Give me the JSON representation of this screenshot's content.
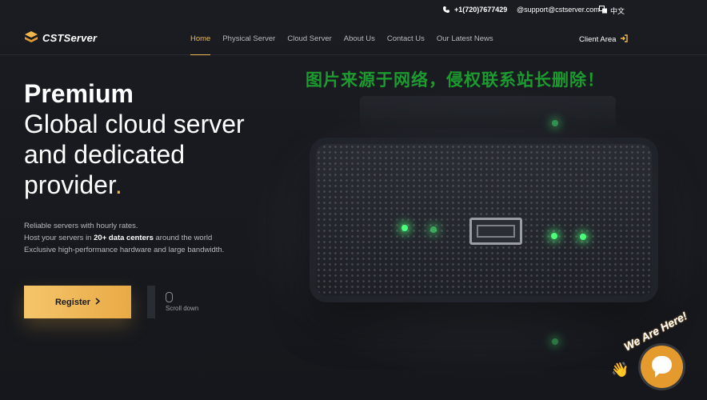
{
  "topbar": {
    "phone": "+1(720)7677429",
    "email": "@support@cstserver.com",
    "language": "中文"
  },
  "header": {
    "logo_text": "CSTServer",
    "nav": [
      {
        "label": "Home",
        "active": true
      },
      {
        "label": "Physical Server"
      },
      {
        "label": "Cloud Server"
      },
      {
        "label": "About Us"
      },
      {
        "label": "Contact Us"
      },
      {
        "label": "Our Latest News"
      }
    ],
    "client_area": "Client Area"
  },
  "watermark": "图片来源于网络，侵权联系站长删除！",
  "hero": {
    "title_bold": "Premium",
    "lines": [
      "Global cloud server",
      "and dedicated",
      "provider"
    ],
    "title_dot": ".",
    "sub1": "Reliable servers with hourly rates.",
    "sub2_pre": "Host your servers in ",
    "sub2_bold": "20+ data centers",
    "sub2_post": " around the world",
    "sub3": "Exclusive high-performance hardware and large bandwidth.",
    "register_label": "Register",
    "scroll_label": "Scroll down"
  },
  "chat": {
    "label": "We Are Here!"
  },
  "colors": {
    "accent": "#f2b84b",
    "background": "#17191f",
    "watermark": "#1c9b2e",
    "led": "#4cff7a"
  }
}
